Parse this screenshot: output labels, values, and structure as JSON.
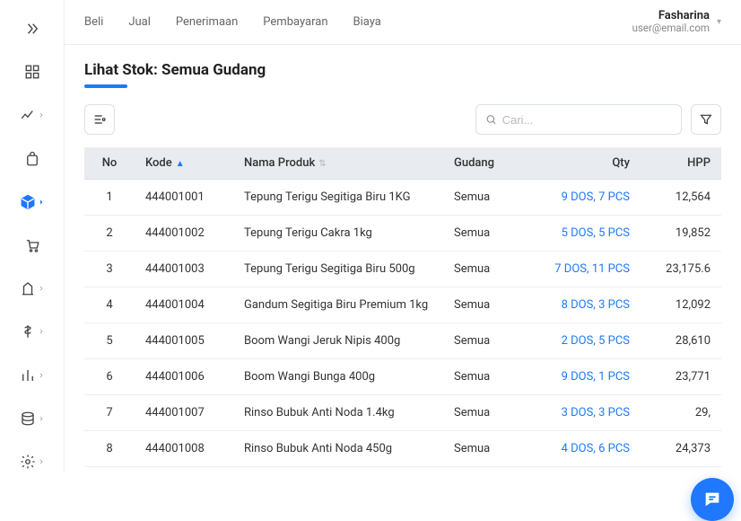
{
  "user": {
    "name": "Fasharina",
    "email": "user@email.com"
  },
  "topnav": [
    "Beli",
    "Jual",
    "Penerimaan",
    "Pembayaran",
    "Biaya"
  ],
  "page_title": "Lihat Stok: Semua Gudang",
  "search": {
    "placeholder": "Cari..."
  },
  "columns": {
    "no": "No",
    "kode": "Kode",
    "nama": "Nama Produk",
    "gudang": "Gudang",
    "qty": "Qty",
    "hpp": "HPP"
  },
  "rows": [
    {
      "no": "1",
      "kode": "444001001",
      "nama": "Tepung Terigu Segitiga Biru 1KG",
      "gudang": "Semua",
      "qty": "9 DOS, 7 PCS",
      "hpp": "12,564"
    },
    {
      "no": "2",
      "kode": "444001002",
      "nama": "Tepung Terigu Cakra 1kg",
      "gudang": "Semua",
      "qty": "5 DOS, 5 PCS",
      "hpp": "19,852"
    },
    {
      "no": "3",
      "kode": "444001003",
      "nama": "Tepung Terigu Segitiga Biru 500g",
      "gudang": "Semua",
      "qty": "7 DOS, 11 PCS",
      "hpp": "23,175.6"
    },
    {
      "no": "4",
      "kode": "444001004",
      "nama": "Gandum Segitiga Biru Premium 1kg",
      "gudang": "Semua",
      "qty": "8 DOS, 3 PCS",
      "hpp": "12,092"
    },
    {
      "no": "5",
      "kode": "444001005",
      "nama": "Boom Wangi Jeruk Nipis 400g",
      "gudang": "Semua",
      "qty": "2 DOS, 5 PCS",
      "hpp": "28,610"
    },
    {
      "no": "6",
      "kode": "444001006",
      "nama": "Boom Wangi Bunga 400g",
      "gudang": "Semua",
      "qty": "9 DOS, 1 PCS",
      "hpp": "23,771"
    },
    {
      "no": "7",
      "kode": "444001007",
      "nama": "Rinso Bubuk Anti Noda 1.4kg",
      "gudang": "Semua",
      "qty": "3 DOS, 3 PCS",
      "hpp": "29,"
    },
    {
      "no": "8",
      "kode": "444001008",
      "nama": "Rinso Bubuk Anti Noda 450g",
      "gudang": "Semua",
      "qty": "4 DOS, 6 PCS",
      "hpp": "24,373"
    }
  ]
}
